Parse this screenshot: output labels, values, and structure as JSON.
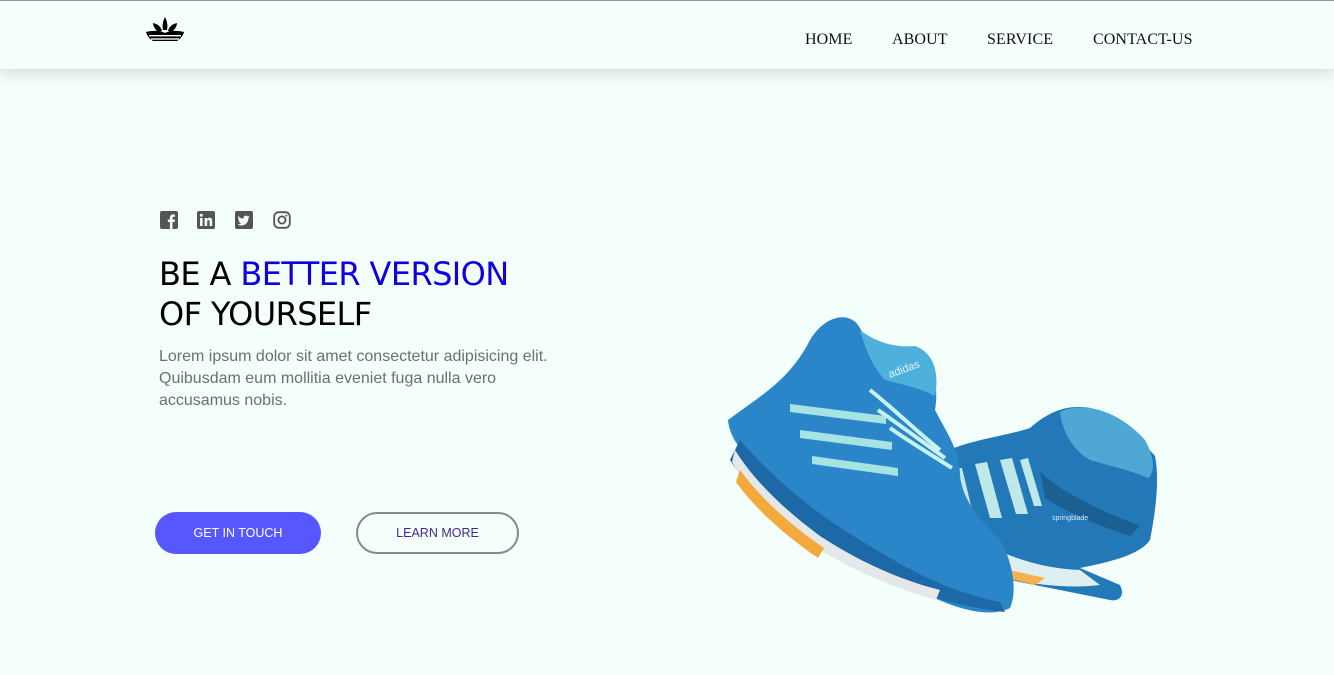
{
  "header": {
    "nav": [
      {
        "label": "HOME"
      },
      {
        "label": "ABOUT"
      },
      {
        "label": "SERVICE"
      },
      {
        "label": "CONTACT-US"
      }
    ]
  },
  "social": [
    "facebook-icon",
    "linkedin-icon",
    "twitter-icon",
    "instagram-icon"
  ],
  "hero": {
    "title_part1": "BE A ",
    "title_accent": "BETTER VERSION",
    "title_part2": "OF YOURSELF",
    "description": "Lorem ipsum dolor sit amet consectetur adipisicing elit. Quibusdam eum mollitia eveniet fuga nulla vero accusamus nobis.",
    "primary_button": "GET IN TOUCH",
    "secondary_button": "LEARN MORE"
  },
  "colors": {
    "background": "#f4fefb",
    "accent": "#0e00e0",
    "primary_button": "#5757ff"
  }
}
